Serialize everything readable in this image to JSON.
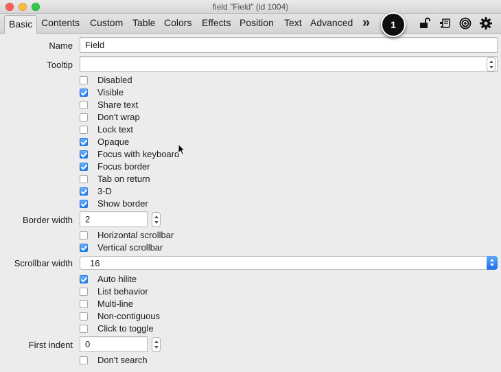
{
  "window": {
    "title": "field \"Field\" (id 1004)"
  },
  "toolbar": {
    "tabs": [
      {
        "label": "Basic"
      },
      {
        "label": "Contents"
      },
      {
        "label": "Custom"
      },
      {
        "label": "Table"
      },
      {
        "label": "Colors"
      },
      {
        "label": "Effects"
      },
      {
        "label": "Position"
      },
      {
        "label": "Text"
      },
      {
        "label": "Advanced"
      }
    ],
    "more": "»",
    "badge": "1",
    "icons": [
      "unlock-icon",
      "script-icon",
      "target-icon",
      "gear-icon"
    ]
  },
  "form": {
    "name_label": "Name",
    "name_value": "Field",
    "tooltip_label": "Tooltip",
    "tooltip_value": "",
    "border_width_label": "Border width",
    "border_width_value": "2",
    "scrollbar_width_label": "Scrollbar width",
    "scrollbar_width_value": "16",
    "first_indent_label": "First indent",
    "first_indent_value": "0"
  },
  "checkboxes": [
    {
      "label": "Disabled",
      "checked": false
    },
    {
      "label": "Visible",
      "checked": true
    },
    {
      "label": "Share text",
      "checked": false
    },
    {
      "label": "Don't wrap",
      "checked": false
    },
    {
      "label": "Lock text",
      "checked": false
    },
    {
      "label": "Opaque",
      "checked": true
    },
    {
      "label": "Focus with keyboard",
      "checked": true
    },
    {
      "label": "Focus border",
      "checked": true
    },
    {
      "label": "Tab on return",
      "checked": false
    },
    {
      "label": "3-D",
      "checked": true
    },
    {
      "label": "Show border",
      "checked": true
    },
    {
      "label": "Horizontal scrollbar",
      "checked": false
    },
    {
      "label": "Vertical scrollbar",
      "checked": true
    },
    {
      "label": "Auto hilite",
      "checked": true
    },
    {
      "label": "List behavior",
      "checked": false
    },
    {
      "label": "Multi-line",
      "checked": false
    },
    {
      "label": "Non-contiguous",
      "checked": false
    },
    {
      "label": "Click to toggle",
      "checked": false
    },
    {
      "label": "Don't search",
      "checked": false
    }
  ]
}
